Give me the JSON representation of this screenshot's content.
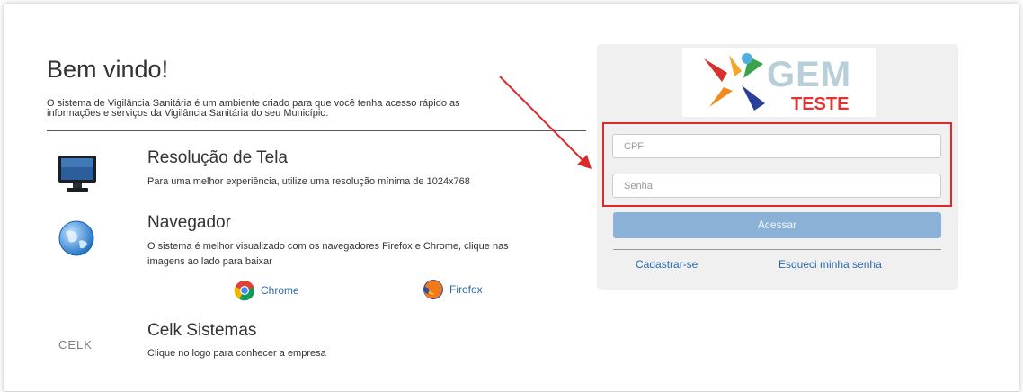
{
  "welcome": {
    "title": "Bem vindo!",
    "description_line1": "O sistema de Vigilância Sanitária é um ambiente criado para que você tenha acesso rápido as",
    "description_line2": "informações e serviços da Vigilância Sanitária do seu Município."
  },
  "features": {
    "screen": {
      "heading": "Resolução de Tela",
      "text": "Para uma melhor experiência, utilize uma resolução mínima de 1024x768",
      "icon": "monitor-icon"
    },
    "browser": {
      "heading": "Navegador",
      "text_line1": "O sistema é melhor visualizado com os navegadores Firefox e Chrome, clique nas",
      "text_line2": "imagens ao lado para baixar",
      "icon": "globe-icon",
      "chrome_label": "Chrome",
      "firefox_label": "Firefox"
    },
    "company": {
      "heading": "Celk Sistemas",
      "text": "Clique no logo para conhecer a empresa",
      "logo_text": "CELK"
    }
  },
  "login": {
    "logo_gem": "GEM",
    "logo_teste": "TESTE",
    "cpf_placeholder": "CPF",
    "password_placeholder": "Senha",
    "submit_label": "Acessar",
    "register_label": "Cadastrar-se",
    "forgot_label": "Esqueci minha senha"
  },
  "colors": {
    "accent_button": "#8bb1d6",
    "link": "#2a6aa8",
    "highlight": "#dc2a2a",
    "logo_red": "#e03434"
  }
}
